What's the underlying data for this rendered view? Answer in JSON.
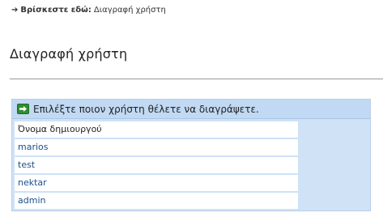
{
  "breadcrumb": {
    "prefix": "Βρίσκεστε εδώ:",
    "current": "Διαγραφή χρήστη"
  },
  "page": {
    "title": "Διαγραφή χρήστη"
  },
  "panel": {
    "header_text": "Επιλέξτε ποιον χρήστη θέλετε να διαγράψετε.",
    "column_header": "Όνομα δημιουργού",
    "users": [
      "marios",
      "test",
      "nektar",
      "admin"
    ]
  },
  "colors": {
    "panel_bg": "#cfe2f6",
    "header_bg": "#c1d9f3",
    "link": "#1b4f8a",
    "go_icon": "#2f8f2f"
  },
  "icons": {
    "breadcrumb": "arrow-right-icon",
    "header": "go-arrow-icon"
  }
}
